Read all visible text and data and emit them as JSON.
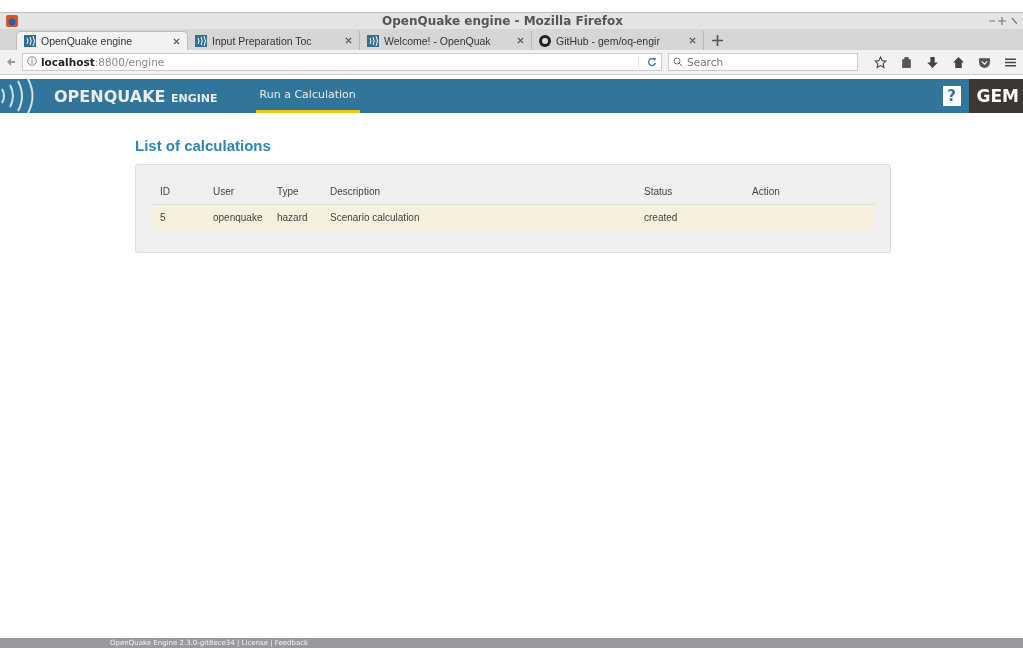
{
  "window": {
    "title": "OpenQuake engine - Mozilla Firefox"
  },
  "tabs": [
    {
      "label": "OpenQuake engine",
      "selected": true,
      "kind": "oq"
    },
    {
      "label": "Input Preparation Toc",
      "selected": false,
      "kind": "oq"
    },
    {
      "label": "Welcome! - OpenQuak",
      "selected": false,
      "kind": "oq"
    },
    {
      "label": "GitHub - gem/oq-engir",
      "selected": false,
      "kind": "github"
    }
  ],
  "address": {
    "host": "localhost",
    "rest": ":8800/engine"
  },
  "search": {
    "placeholder": "Search"
  },
  "header": {
    "logo_main": "OPENQUAKE",
    "logo_sub": "ENGINE",
    "nav": [
      {
        "label": "Run a Calculation",
        "selected": true
      }
    ],
    "help": "?",
    "brand": "GEM"
  },
  "page": {
    "heading": "List of calculations",
    "table": {
      "columns": [
        "ID",
        "User",
        "Type",
        "Description",
        "Status",
        "Action"
      ],
      "rows": [
        {
          "cells": [
            "5",
            "openquake",
            "hazard",
            "Scenario calculation",
            "created"
          ],
          "selected": true
        }
      ]
    }
  },
  "footer": {
    "text": "OpenQuake Engine 2.3.0-git8ece34 | License | Feedback"
  }
}
